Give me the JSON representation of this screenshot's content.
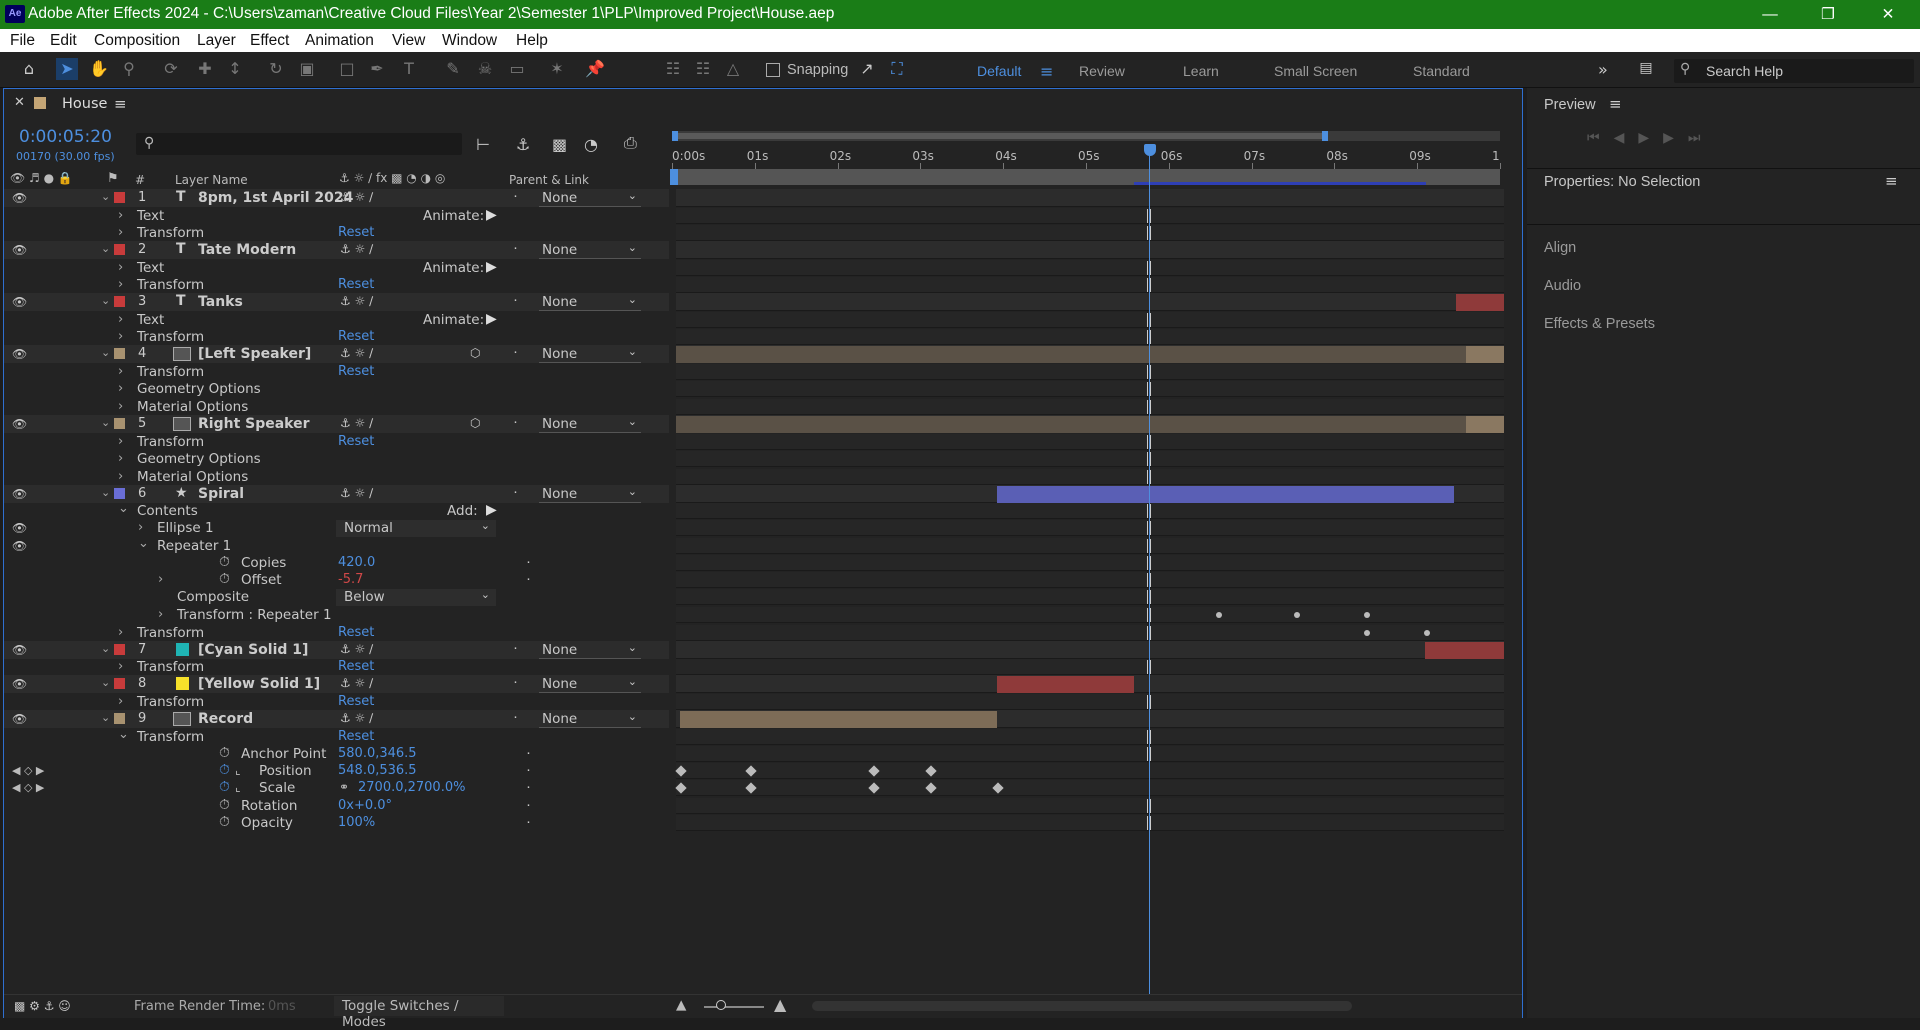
{
  "window": {
    "title": "Adobe After Effects 2024 - C:\\Users\\zaman\\Creative Cloud Files\\Year 2\\Semester 1\\PLP\\Improved Project\\House.aep",
    "logo": "Ae"
  },
  "menu": [
    "File",
    "Edit",
    "Composition",
    "Layer",
    "Effect",
    "Animation",
    "View",
    "Window",
    "Help"
  ],
  "toolbar": {
    "snapping": "Snapping",
    "workspaces": [
      "Default",
      "Review",
      "Learn",
      "Small Screen",
      "Standard"
    ],
    "search_placeholder": "Search Help"
  },
  "comp_panel": {
    "tab": "House",
    "timecode": "0:00:05:20",
    "frame_info": "00170 (30.00 fps)",
    "col_layer_name": "Layer Name",
    "col_num": "#",
    "col_parent": "Parent & Link",
    "ruler": [
      "0:00s",
      "01s",
      "02s",
      "03s",
      "04s",
      "05s",
      "06s",
      "07s",
      "08s",
      "09s",
      "1"
    ],
    "footer_render": "Frame Render Time:",
    "footer_render_val": "0ms",
    "footer_toggle": "Toggle Switches / Modes"
  },
  "rows": [
    {
      "type": "layer",
      "num": "1",
      "name": "8pm, 1st April 2024",
      "kind": "T",
      "color": "#c83b3b",
      "parent": "None"
    },
    {
      "type": "prop",
      "name": "Text",
      "extra": "Animate:"
    },
    {
      "type": "prop",
      "name": "Transform",
      "value": "Reset"
    },
    {
      "type": "layer",
      "num": "2",
      "name": "Tate Modern",
      "kind": "T",
      "color": "#c83b3b",
      "parent": "None"
    },
    {
      "type": "prop",
      "name": "Text",
      "extra": "Animate:"
    },
    {
      "type": "prop",
      "name": "Transform",
      "value": "Reset"
    },
    {
      "type": "layer",
      "num": "3",
      "name": "Tanks",
      "kind": "T",
      "color": "#c83b3b",
      "parent": "None"
    },
    {
      "type": "prop",
      "name": "Text",
      "extra": "Animate:"
    },
    {
      "type": "prop",
      "name": "Transform",
      "value": "Reset"
    },
    {
      "type": "layer",
      "num": "4",
      "name": "[Left Speaker]",
      "kind": "img",
      "color": "#a89270",
      "parent": "None"
    },
    {
      "type": "prop",
      "name": "Transform",
      "value": "Reset"
    },
    {
      "type": "prop",
      "name": "Geometry Options"
    },
    {
      "type": "prop",
      "name": "Material Options"
    },
    {
      "type": "layer",
      "num": "5",
      "name": "Right Speaker",
      "kind": "img",
      "color": "#a89270",
      "parent": "None"
    },
    {
      "type": "prop",
      "name": "Transform",
      "value": "Reset"
    },
    {
      "type": "prop",
      "name": "Geometry Options"
    },
    {
      "type": "prop",
      "name": "Material Options"
    },
    {
      "type": "layer",
      "num": "6",
      "name": "Spiral",
      "kind": "star",
      "color": "#6a6ed6",
      "parent": "None"
    },
    {
      "type": "prop",
      "name": "Contents",
      "extra": "Add:",
      "open": true
    },
    {
      "type": "sub",
      "name": "Ellipse 1",
      "value": "Normal",
      "dd": true,
      "eye": true
    },
    {
      "type": "sub",
      "name": "Repeater 1",
      "open": true,
      "eye": true
    },
    {
      "type": "sub2",
      "name": "Copies",
      "value": "420.0",
      "stop": true
    },
    {
      "type": "sub2",
      "name": "Offset",
      "value": "-5.7",
      "stop": true,
      "red": true,
      "arrow": true
    },
    {
      "type": "sub2",
      "name": "Composite",
      "value": "Below",
      "dd": true
    },
    {
      "type": "sub2b",
      "name": "Transform : Repeater 1",
      "arrow": true
    },
    {
      "type": "prop",
      "name": "Transform",
      "value": "Reset"
    },
    {
      "type": "layer",
      "num": "7",
      "name": "[Cyan Solid 1]",
      "kind": "cyan",
      "color": "#c83b3b",
      "parent": "None"
    },
    {
      "type": "prop",
      "name": "Transform",
      "value": "Reset"
    },
    {
      "type": "layer",
      "num": "8",
      "name": "[Yellow Solid 1]",
      "kind": "yellow",
      "color": "#c83b3b",
      "parent": "None"
    },
    {
      "type": "prop",
      "name": "Transform",
      "value": "Reset"
    },
    {
      "type": "layer",
      "num": "9",
      "name": "Record",
      "kind": "img",
      "color": "#a89270",
      "parent": "None"
    },
    {
      "type": "prop",
      "name": "Transform",
      "value": "Reset",
      "open": true
    },
    {
      "type": "sub2",
      "name": "Anchor Point",
      "value": "580.0,346.5",
      "stop": true
    },
    {
      "type": "sub2",
      "name": "Position",
      "value": "548.0,536.5",
      "stop": true,
      "kf": true,
      "graph": true
    },
    {
      "type": "sub2",
      "name": "Scale",
      "value": "2700.0,2700.0%",
      "stop": true,
      "kf": true,
      "graph": true,
      "link": true
    },
    {
      "type": "sub2",
      "name": "Rotation",
      "value": "0x+0.0°",
      "stop": true
    },
    {
      "type": "sub2",
      "name": "Opacity",
      "value": "100%",
      "stop": true
    }
  ],
  "right_panel": {
    "preview": "Preview",
    "properties": "Properties: No Selection",
    "sections": [
      "Align",
      "Audio",
      "Effects & Presets"
    ]
  },
  "colors": {
    "accent": "#4d8fdf",
    "titlebar": "#1a7d17"
  }
}
